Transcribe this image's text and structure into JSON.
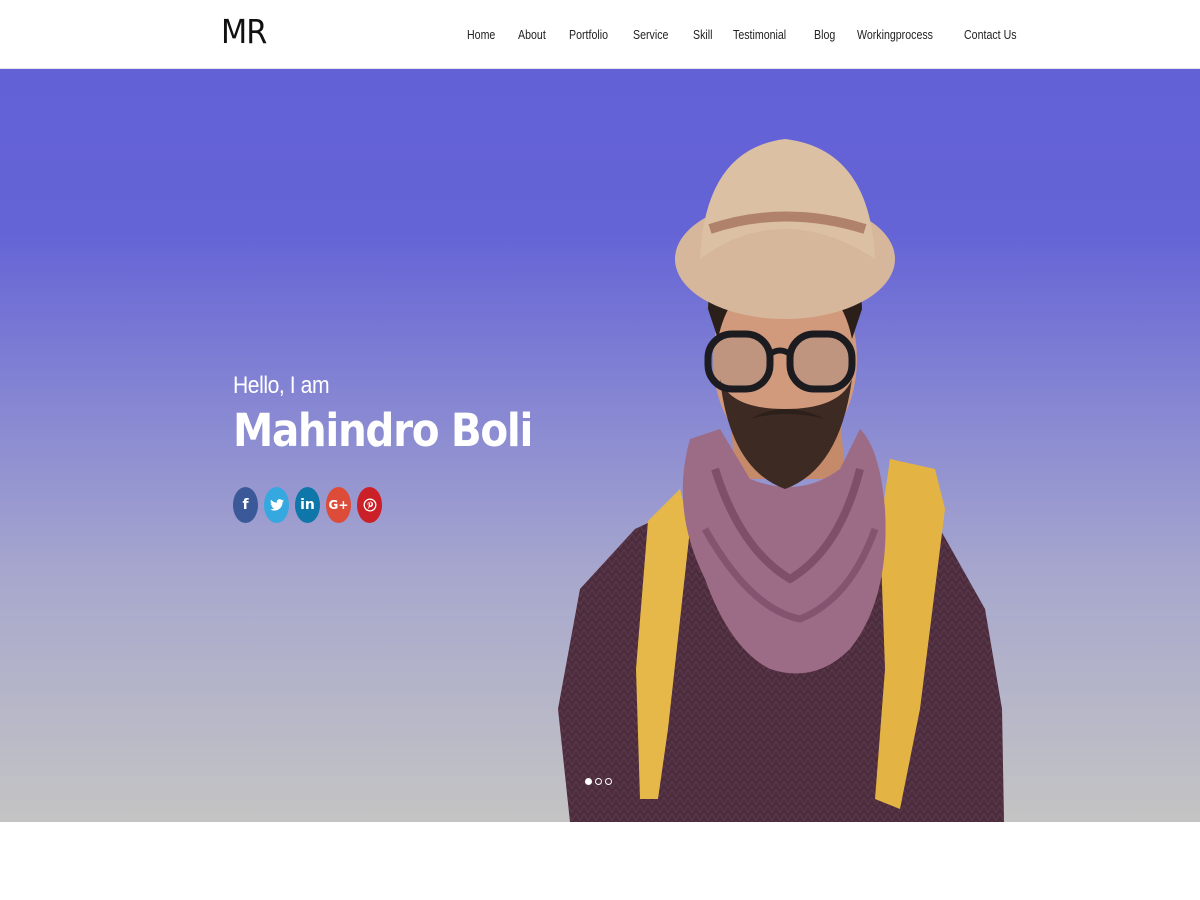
{
  "header": {
    "logo": "MR",
    "nav": [
      "Home",
      "About",
      "Portfolio",
      "Service",
      "Skill",
      "Testimonial",
      "Blog",
      "Workingprocess",
      "Contact Us"
    ]
  },
  "hero": {
    "greeting": "Hello, I am",
    "name": "Mahindro Boli",
    "gradient_top": "#6261d6",
    "gradient_bottom": "#c4c4c4"
  },
  "social": [
    {
      "icon": "facebook-icon",
      "glyph": "f",
      "color": "#3b5998"
    },
    {
      "icon": "twitter-icon",
      "glyph": "🐦",
      "color": "#35a8e0"
    },
    {
      "icon": "linkedin-icon",
      "glyph": "in",
      "color": "#0e76a8"
    },
    {
      "icon": "google-plus-icon",
      "glyph": "G+",
      "color": "#dd4b39"
    },
    {
      "icon": "pinterest-icon",
      "glyph": "℗",
      "color": "#cb2027"
    }
  ],
  "slider": {
    "slide_count": 3,
    "active_slide": 1
  }
}
